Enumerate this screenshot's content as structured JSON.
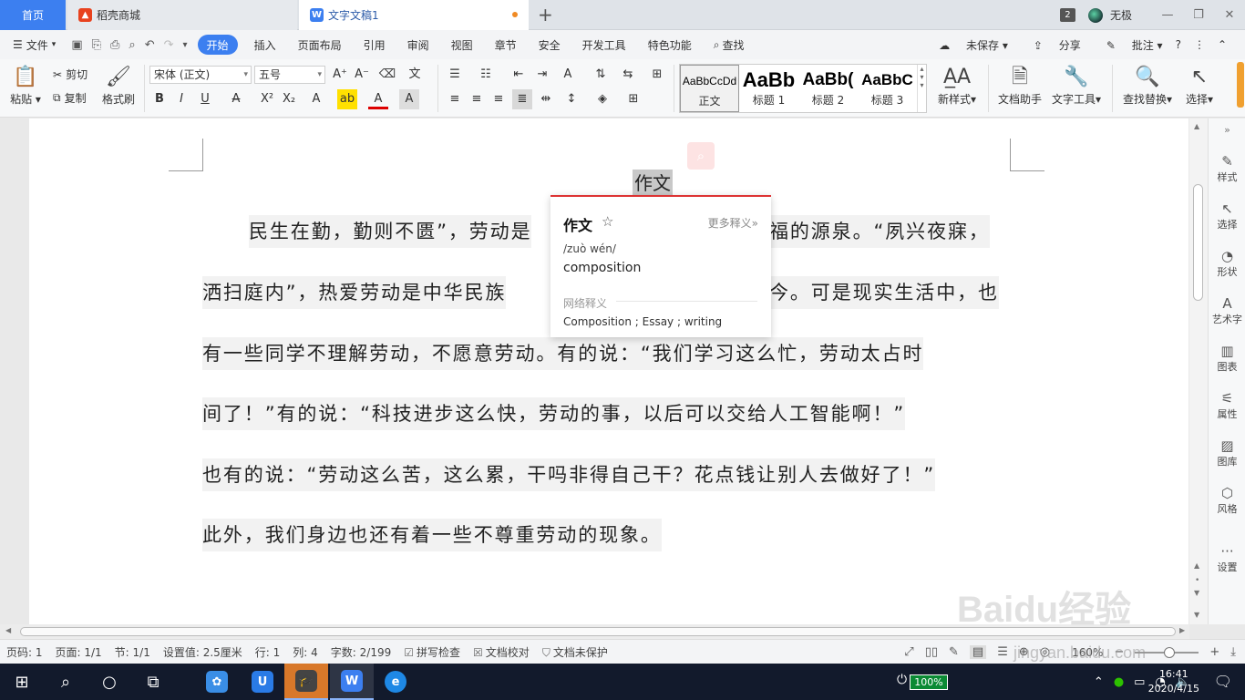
{
  "tabs": {
    "home": "首页",
    "shop": "稻壳商城",
    "doc": "文字文稿1",
    "badge": "2",
    "user": "无极"
  },
  "menu": {
    "file": "文件",
    "items": [
      "开始",
      "插入",
      "页面布局",
      "引用",
      "审阅",
      "视图",
      "章节",
      "安全",
      "开发工具",
      "特色功能"
    ],
    "search": "查找",
    "unsaved": "未保存",
    "share": "分享",
    "comment": "批注"
  },
  "ribbon": {
    "paste": "粘贴",
    "cut": "剪切",
    "copy": "复制",
    "format_painter": "格式刷",
    "font_name": "宋体 (正文)",
    "font_size": "五号",
    "styles": [
      {
        "preview": "AaBbCcDd",
        "name": "正文"
      },
      {
        "preview": "AaBb",
        "name": "标题 1"
      },
      {
        "preview": "AaBb(",
        "name": "标题 2"
      },
      {
        "preview": "AaBbC",
        "name": "标题 3"
      }
    ],
    "new_style": "新样式",
    "doc_helper": "文档助手",
    "text_tools": "文字工具",
    "find_replace": "查找替换",
    "select": "选择"
  },
  "document": {
    "title": "作文",
    "lines": [
      "民生在勤，勤则不匮”，劳动是",
      "福的源泉。“夙兴夜寐，",
      "洒扫庭内”，热爱劳动是中华民族",
      "今。可是现实生活中，也",
      "有一些同学不理解劳动，不愿意劳动。有的说：“我们学习这么忙，劳动太占时",
      "间了！”有的说：“科技进步这么快，劳动的事，以后可以交给人工智能啊！”",
      "也有的说：“劳动这么苦，这么累，干吗非得自己干？花点钱让别人去做好了！”",
      "此外，我们身边也还有着一些不尊重劳动的现象。"
    ]
  },
  "dictionary": {
    "headword": "作文",
    "more": "更多释义»",
    "pinyin": "/zuò wén/",
    "english": "composition",
    "net_label": "网络释义",
    "net_value": "Composition ; Essay ; writing"
  },
  "sidepanel": [
    "样式",
    "选择",
    "形状",
    "艺术字",
    "图表",
    "属性",
    "图库",
    "风格",
    "设置"
  ],
  "status": {
    "page_no": "页码: 1",
    "pages": "页面: 1/1",
    "section": "节: 1/1",
    "setting": "设置值: 2.5厘米",
    "row": "行: 1",
    "col": "列: 4",
    "words": "字数: 2/199",
    "spell": "拼写检查",
    "proof": "文档校对",
    "protect": "文档未保护",
    "zoom": "160%"
  },
  "watermark": {
    "logo": "Baidu经验",
    "url": "jingyan.baidu.com"
  },
  "taskbar": {
    "battery": "100%",
    "time": "16:41",
    "date": "2020/4/15"
  }
}
